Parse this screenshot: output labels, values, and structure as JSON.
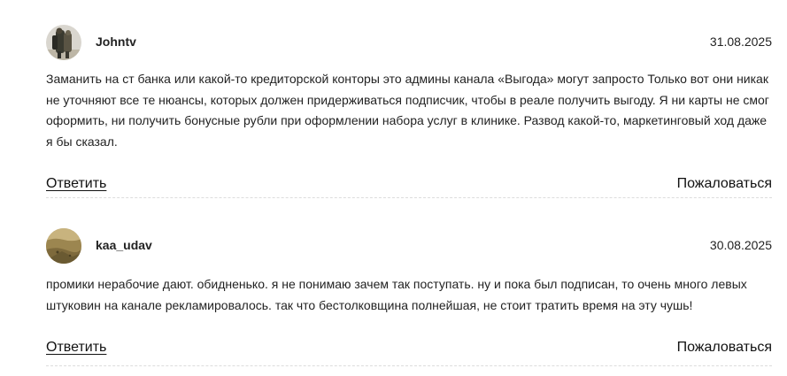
{
  "comments": [
    {
      "author": "Johntv",
      "date": "31.08.2025",
      "text": "Заманить на ст банка или какой-то кредиторской конторы это админы канала «Выгода» могут запросто Только вот они никак не уточняют все те нюансы, которых должен придерживаться подписчик, чтобы в реале получить выгоду. Я ни карты не смог оформить, ни получить бонусные рубли при оформлении набора услуг в клинике. Развод какой-то, маркетинговый ход даже я бы сказал.",
      "reply_label": "Ответить",
      "report_label": "Пожаловаться",
      "avatar_icon": "user-photo-avatar"
    },
    {
      "author": "kaa_udav",
      "date": "30.08.2025",
      "text": "промики нерабочие дают. обидненько. я не понимаю зачем так поступать. ну и пока был подписан, то очень много левых штуковин на канале рекламировалось. так что бестолковщина полнейшая, не стоит тратить время на эту чушь!",
      "reply_label": "Ответить",
      "report_label": "Пожаловаться",
      "avatar_icon": "landscape-photo-avatar"
    }
  ],
  "colors": {
    "text": "#222222",
    "divider": "#dcdcdc",
    "background": "#ffffff"
  }
}
